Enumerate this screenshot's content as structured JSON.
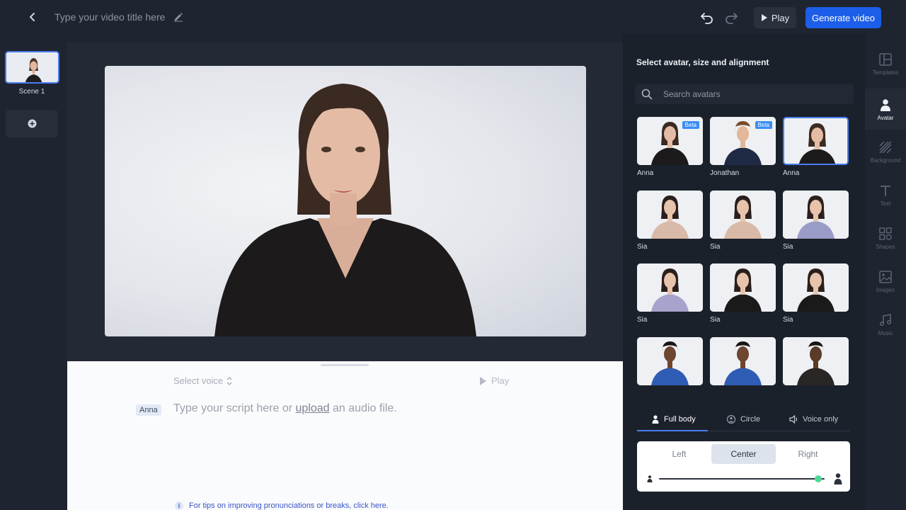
{
  "header": {
    "title_placeholder": "Type your video title here",
    "play_label": "Play",
    "generate_label": "Generate video"
  },
  "scenes": {
    "items": [
      {
        "label": "Scene 1"
      }
    ]
  },
  "script": {
    "select_voice": "Select voice",
    "play_label": "Play",
    "speaker": "Anna",
    "text_before": "Type your script here or",
    "upload_link": "upload",
    "text_after": "an audio file.",
    "tip": "For tips on improving pronunciations or breaks, click here."
  },
  "avatar_panel": {
    "title": "Select avatar, size and alignment",
    "search_placeholder": "Search avatars",
    "avatars": [
      {
        "name": "Anna",
        "badge": "Beta",
        "selected": false
      },
      {
        "name": "Jonathan",
        "badge": "Beta",
        "selected": false
      },
      {
        "name": "Anna",
        "badge": "",
        "selected": true
      },
      {
        "name": "Sia",
        "badge": "",
        "selected": false
      },
      {
        "name": "Sia",
        "badge": "",
        "selected": false
      },
      {
        "name": "Sia",
        "badge": "",
        "selected": false
      },
      {
        "name": "Sia",
        "badge": "",
        "selected": false
      },
      {
        "name": "Sia",
        "badge": "",
        "selected": false
      },
      {
        "name": "Sia",
        "badge": "",
        "selected": false
      },
      {
        "name": "",
        "badge": "",
        "selected": false
      },
      {
        "name": "",
        "badge": "",
        "selected": false
      },
      {
        "name": "",
        "badge": "",
        "selected": false
      }
    ],
    "layout_tabs": [
      {
        "label": "Full body",
        "icon": "person-icon",
        "active": true
      },
      {
        "label": "Circle",
        "icon": "circle-avatar-icon",
        "active": false
      },
      {
        "label": "Voice only",
        "icon": "speaker-icon",
        "active": false
      }
    ],
    "alignment": [
      {
        "label": "Left",
        "active": false
      },
      {
        "label": "Center",
        "active": true
      },
      {
        "label": "Right",
        "active": false
      }
    ],
    "size_slider_value": 0.96
  },
  "rail": {
    "items": [
      {
        "label": "Templates",
        "icon": "templates-icon",
        "active": false
      },
      {
        "label": "Avatar",
        "icon": "avatar-icon",
        "active": true
      },
      {
        "label": "Background",
        "icon": "background-icon",
        "active": false
      },
      {
        "label": "Text",
        "icon": "text-icon",
        "active": false
      },
      {
        "label": "Shapes",
        "icon": "shapes-icon",
        "active": false
      },
      {
        "label": "Images",
        "icon": "images-icon",
        "active": false
      },
      {
        "label": "Music",
        "icon": "music-icon",
        "active": false
      }
    ]
  },
  "colors": {
    "accent": "#1d5ee8",
    "selection": "#4a7df0",
    "slider": "#4fd898"
  }
}
